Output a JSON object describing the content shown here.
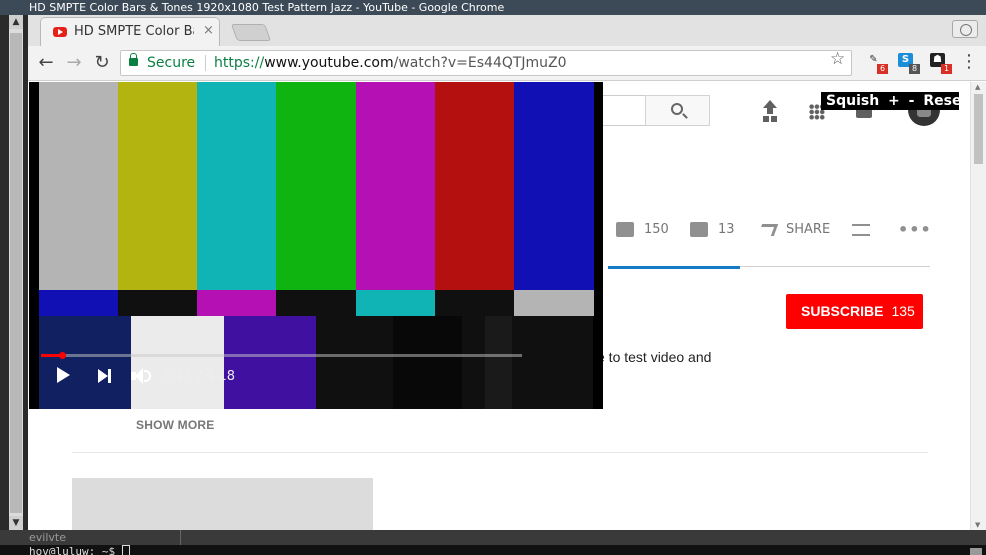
{
  "window": {
    "title": "HD SMPTE Color Bars & Tones 1920x1080 Test Pattern Jazz - YouTube - Google Chrome"
  },
  "tab": {
    "title": "HD SMPTE Color Bar",
    "close": "×"
  },
  "toolbar": {
    "back": "←",
    "forward": "→",
    "reload": "↻",
    "secure_label": "Secure",
    "url_scheme": "https://",
    "url_host": "www.youtube.com",
    "url_path": "/watch?v=Es44QTJmuZ0",
    "star": "☆",
    "menu": "⋮"
  },
  "extensions": [
    {
      "name": "wrench-extension-icon",
      "badge": "6",
      "color": "#333333",
      "badge_color": "#d93025"
    },
    {
      "name": "skype-extension-icon",
      "badge": "8",
      "color": "#1a8fd8",
      "badge_color": "#555555"
    },
    {
      "name": "ghostery-extension-icon",
      "badge": "1",
      "color": "#222222",
      "badge_color": "#d93025"
    }
  ],
  "squish": {
    "label": "Squish",
    "plus": "+",
    "minus": "-",
    "reset": "Reset"
  },
  "video": {
    "time": "0:11 / 4:18",
    "progress_fraction": 0.043,
    "colors": {
      "top": [
        "#b4b4b4",
        "#b4b410",
        "#10b4b4",
        "#10b410",
        "#b410b4",
        "#b41010",
        "#1010b4"
      ],
      "middle": [
        "#1010b4",
        "#101010",
        "#b410b4",
        "#101010",
        "#10b4b4",
        "#101010",
        "#b4b4b4"
      ],
      "bottom": [
        "#102060",
        "#ebebeb",
        "#4010a0",
        "#101010",
        "#080808",
        "#101010",
        "#1a1a1a",
        "#101010",
        "#101010"
      ]
    }
  },
  "actions": {
    "likes": "150",
    "dislikes": "13",
    "share": "SHARE",
    "likes_fraction": 0.92
  },
  "channel": {
    "subscribe_label": "SUBSCRIBE",
    "subscribers": "135"
  },
  "description": {
    "text": "e to test video and",
    "show_more": "SHOW MORE"
  },
  "terminal": {
    "tab_label": "evilvte",
    "prompt": "hov@luluw: ~$ "
  }
}
